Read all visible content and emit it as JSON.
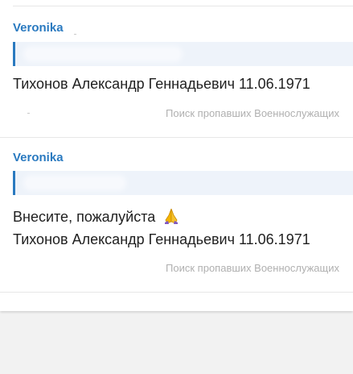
{
  "messages": [
    {
      "author": "Veronika",
      "lines": [
        "Тихонов Александр Геннадьевич 11.06.1971"
      ],
      "source": "Поиск пропавших Военнослужащих"
    },
    {
      "author": "Veronika",
      "lines": [
        "Внесите, пожалуйста",
        "Тихонов Александр Геннадьевич 11.06.1971"
      ],
      "emoji": "praying-hands-icon",
      "source": "Поиск пропавших Военнослужащих"
    }
  ],
  "colors": {
    "author": "#2a7ac0",
    "quote_bar": "#2a7ac0",
    "quote_bg": "#eef3fa",
    "text": "#1f1f1f",
    "source": "#b0b0b0",
    "background": "#f2f2f2",
    "emoji": "#f4b400"
  }
}
